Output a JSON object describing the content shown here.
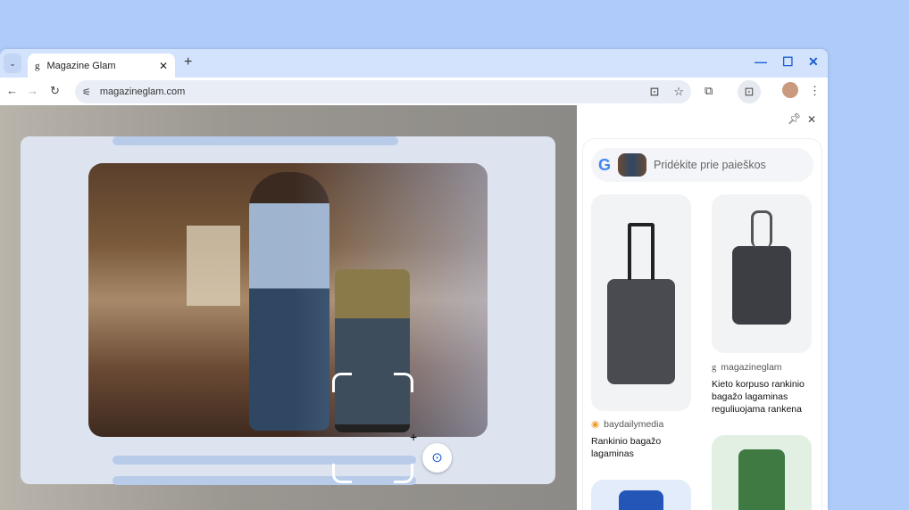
{
  "browser": {
    "tab_title": "Magazine Glam",
    "url": "magazineglam.com"
  },
  "side_panel": {
    "search_placeholder": "Pridėkite prie paieškos",
    "results": [
      {
        "source": "baydailymedia",
        "title": "Rankinio bagažo lagaminas",
        "color": "#4a4b50"
      },
      {
        "source": "magazineglam",
        "title": "Kieto korpuso rankinio bagažo lagaminas reguliuojama rankena",
        "color": "#3d3e44"
      },
      {
        "source": "",
        "title": "",
        "color": "#2456b8"
      },
      {
        "source": "",
        "title": "",
        "color": "#3f7a43"
      }
    ]
  },
  "colors": {
    "accent": "#1a5fd0",
    "background": "#aecbfa"
  }
}
